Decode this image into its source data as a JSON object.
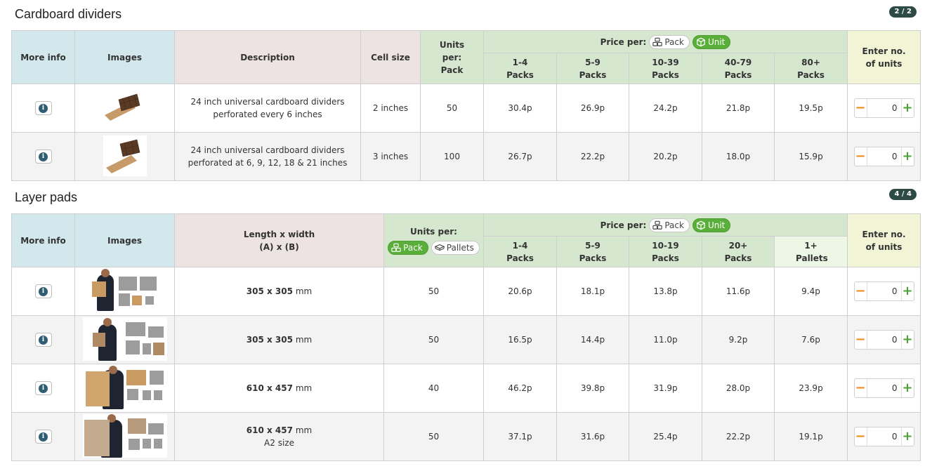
{
  "sections": [
    {
      "title": "Cardboard dividers",
      "badge": "2 / 2",
      "headers": {
        "more_info": "More info",
        "images": "Images",
        "description": "Description",
        "cell_size": "Cell size",
        "units_per": "Units per: Pack",
        "price_per": "Price per:",
        "toggle_pack": "Pack",
        "toggle_unit": "Unit",
        "enter_units": "Enter no. of units",
        "tiers": [
          "1-4 Packs",
          "5-9 Packs",
          "10-39 Packs",
          "40-79 Packs",
          "80+ Packs"
        ]
      },
      "rows": [
        {
          "desc_line1": "24 inch universal cardboard dividers",
          "desc_line2": "perforated every 6 inches",
          "cell_size": "2 inches",
          "units": "50",
          "prices": [
            "30.4p",
            "26.9p",
            "24.2p",
            "21.8p",
            "19.5p"
          ],
          "qty": "0"
        },
        {
          "desc_line1": "24 inch universal cardboard dividers",
          "desc_line2": "perforated at 6, 9, 12, 18 & 21 inches",
          "cell_size": "3 inches",
          "units": "100",
          "prices": [
            "26.7p",
            "22.2p",
            "20.2p",
            "18.0p",
            "15.9p"
          ],
          "qty": "0"
        }
      ]
    },
    {
      "title": "Layer pads",
      "badge": "4 / 4",
      "headers": {
        "more_info": "More info",
        "images": "Images",
        "dims_line1": "Length x width",
        "dims_line2": "(A) x (B)",
        "units_per": "Units per:",
        "units_pack": "Pack",
        "units_pallets": "Pallets",
        "price_per": "Price per:",
        "toggle_pack": "Pack",
        "toggle_unit": "Unit",
        "enter_units": "Enter no. of units",
        "tiers": [
          "1-4 Packs",
          "5-9 Packs",
          "10-19 Packs",
          "20+ Packs",
          "1+ Pallets"
        ]
      },
      "rows": [
        {
          "dims": "305 x 305",
          "unit": "mm",
          "sub": "",
          "units": "50",
          "prices": [
            "20.6p",
            "18.1p",
            "13.8p",
            "11.6p",
            "9.4p"
          ],
          "qty": "0"
        },
        {
          "dims": "305 x 305",
          "unit": "mm",
          "sub": "",
          "units": "50",
          "prices": [
            "16.5p",
            "14.4p",
            "11.0p",
            "9.2p",
            "7.6p"
          ],
          "qty": "0"
        },
        {
          "dims": "610 x 457",
          "unit": "mm",
          "sub": "",
          "units": "40",
          "prices": [
            "46.2p",
            "39.8p",
            "31.9p",
            "28.0p",
            "23.9p"
          ],
          "qty": "0"
        },
        {
          "dims": "610 x 457",
          "unit": "mm",
          "sub": "A2 size",
          "units": "50",
          "prices": [
            "37.1p",
            "31.6p",
            "25.4p",
            "22.2p",
            "19.1p"
          ],
          "qty": "0"
        }
      ]
    }
  ],
  "icons": {
    "info": "info-icon",
    "pack": "boxes-stack-icon",
    "unit": "single-box-icon",
    "pallets": "pallet-icon",
    "minus": "minus-icon",
    "plus": "plus-icon"
  },
  "colors": {
    "accent_green": "#5aae3a",
    "badge": "#2d4a45",
    "minus_orange": "#f08a1c",
    "info_blue": "#2e5d74"
  }
}
